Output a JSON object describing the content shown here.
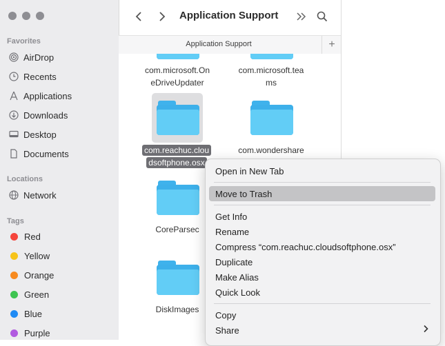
{
  "window": {
    "title": "Application Support"
  },
  "sidebar": {
    "favorites_title": "Favorites",
    "favorites": [
      {
        "label": "AirDrop",
        "icon": "airdrop-icon"
      },
      {
        "label": "Recents",
        "icon": "clock-icon"
      },
      {
        "label": "Applications",
        "icon": "applications-icon"
      },
      {
        "label": "Downloads",
        "icon": "download-icon"
      },
      {
        "label": "Desktop",
        "icon": "desktop-icon"
      },
      {
        "label": "Documents",
        "icon": "document-icon"
      }
    ],
    "locations_title": "Locations",
    "locations": [
      {
        "label": "Network",
        "icon": "globe-icon"
      }
    ],
    "tags_title": "Tags",
    "tags": [
      {
        "label": "Red",
        "color": "#f5443b"
      },
      {
        "label": "Yellow",
        "color": "#f7c41a"
      },
      {
        "label": "Orange",
        "color": "#f78a1f"
      },
      {
        "label": "Green",
        "color": "#3ec451"
      },
      {
        "label": "Blue",
        "color": "#1f8bf5"
      },
      {
        "label": "Purple",
        "color": "#b15be0"
      }
    ]
  },
  "pathbar": {
    "label": "Application Support"
  },
  "files": [
    {
      "name1": "com.microsoft.On",
      "name2": "eDriveUpdater"
    },
    {
      "name1": "com.microsoft.tea",
      "name2": "ms"
    },
    {
      "name1": "com.reachuc.clou",
      "name2": "dsoftphone.osx",
      "selected": true
    },
    {
      "name1": "com.wondershare",
      "name2": ""
    },
    {
      "name1": "CoreParsec",
      "name2": ""
    },
    {
      "name1": "DiskImages",
      "name2": ""
    }
  ],
  "context_menu": {
    "open_new_tab": "Open in New Tab",
    "move_to_trash": "Move to Trash",
    "get_info": "Get Info",
    "rename": "Rename",
    "compress": "Compress “com.reachuc.cloudsoftphone.osx”",
    "duplicate": "Duplicate",
    "make_alias": "Make Alias",
    "quick_look": "Quick Look",
    "copy": "Copy",
    "share": "Share"
  }
}
